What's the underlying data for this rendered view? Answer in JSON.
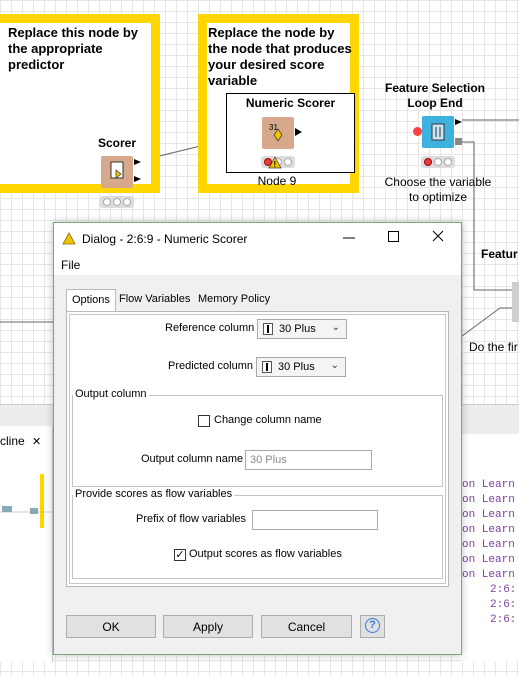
{
  "canvas": {
    "annotation_left": "Replace this node by the appropriate predictor",
    "annotation_right": "Replace the node by the node that produces your desired score variable",
    "scorer_title": "Scorer",
    "numeric_scorer_title": "Numeric Scorer",
    "numeric_scorer_label": "Node 9",
    "fs_loop_end_title_1": "Feature Selection",
    "fs_loop_end_title_2": "Loop End",
    "fs_caption_1": "Choose the variable",
    "fs_caption_2": "to optimize",
    "feature_partial": "Featur",
    "do_partial": "Do the fir",
    "outline_tab": "cline",
    "numeric_icon_text": "31"
  },
  "console": {
    "lines": [
      "on Learn",
      "on Learn",
      "on Learn",
      "on Learn",
      "on Learn",
      "on Learn",
      "on Learn",
      "2:6:",
      "2:6:",
      "2:6:"
    ]
  },
  "dialog": {
    "title": "Dialog - 2:6:9 - Numeric Scorer",
    "menu_file": "File",
    "tabs": [
      "Options",
      "Flow Variables",
      "Memory Policy"
    ],
    "reference_column_label": "Reference column",
    "reference_column_value": "30 Plus",
    "predicted_column_label": "Predicted column",
    "predicted_column_value": "30 Plus",
    "output_column_group": "Output column",
    "change_column_name_label": "Change column name",
    "change_column_name_checked": false,
    "output_column_name_label": "Output column name",
    "output_column_name_value": "30 Plus",
    "flow_vars_group": "Provide scores as flow variables",
    "prefix_label": "Prefix of flow variables",
    "prefix_value": "",
    "output_scores_label": "Output scores as flow variables",
    "output_scores_checked": true,
    "buttons": {
      "ok": "OK",
      "apply": "Apply",
      "cancel": "Cancel",
      "help": "?"
    }
  }
}
